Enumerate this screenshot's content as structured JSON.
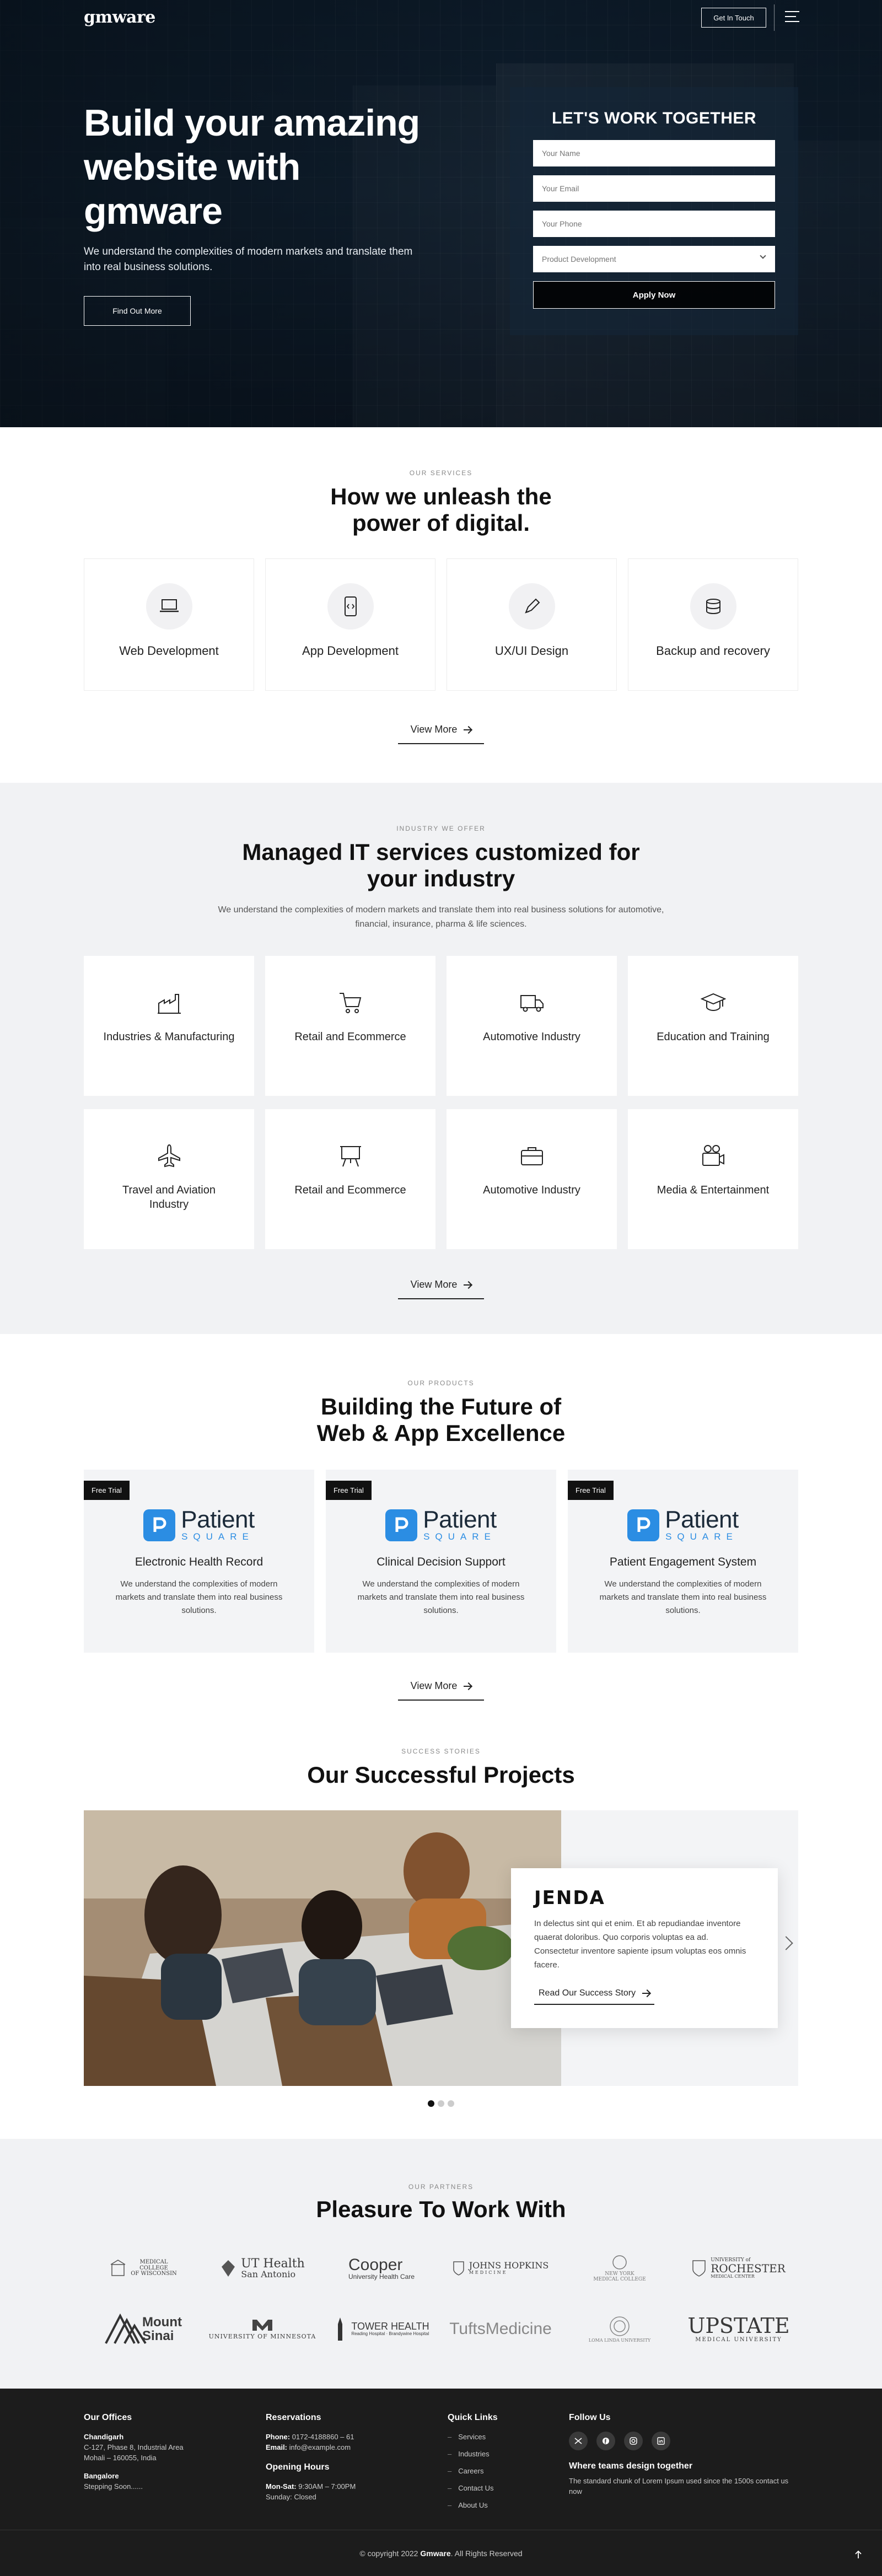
{
  "header": {
    "logo": "gmware",
    "cta_label": "Get In Touch"
  },
  "hero": {
    "title": "Build your amazing website with gmware",
    "subtitle": "We understand the complexities of modern markets and translate them into real business solutions.",
    "cta_label": "Find Out More"
  },
  "form": {
    "title": "LET'S WORK TOGETHER",
    "name_placeholder": "Your Name",
    "email_placeholder": "Your Email",
    "phone_placeholder": "Your Phone",
    "select_value": "Product Development",
    "submit_label": "Apply Now"
  },
  "services": {
    "eyebrow": "OUR SERVICES",
    "title": "How we unleash the power of digital.",
    "items": [
      {
        "label": "Web Development",
        "icon": "laptop-icon"
      },
      {
        "label": "App Development",
        "icon": "mobile-code-icon"
      },
      {
        "label": "UX/UI Design",
        "icon": "pen-icon"
      },
      {
        "label": "Backup and recovery",
        "icon": "database-icon"
      }
    ],
    "view_more": "View More"
  },
  "industries": {
    "eyebrow": "INDUSTRY WE OFFER",
    "title": "Managed IT services customized for your industry",
    "description": "We understand the complexities of modern markets and translate them into real business solutions for automotive, financial, insurance, pharma & life sciences.",
    "items": [
      {
        "label": "Industries & Manufacturing",
        "icon": "factory-icon"
      },
      {
        "label": "Retail and Ecommerce",
        "icon": "cart-icon"
      },
      {
        "label": "Automotive Industry",
        "icon": "truck-icon"
      },
      {
        "label": "Education and Training",
        "icon": "graduation-cap-icon"
      },
      {
        "label": "Travel and Aviation Industry",
        "icon": "airplane-icon"
      },
      {
        "label": "Retail and Ecommerce",
        "icon": "easel-icon"
      },
      {
        "label": "Automotive Industry",
        "icon": "briefcase-icon"
      },
      {
        "label": "Media & Entertainment",
        "icon": "camera-icon"
      }
    ],
    "view_more": "View More"
  },
  "products": {
    "eyebrow": "OUR PRODUCTS",
    "title": "Building the Future of Web & App Excellence",
    "badge": "Free Trial",
    "brand_word": "Patient",
    "brand_sub": "SQUARE",
    "items": [
      {
        "name": "Electronic Health Record",
        "desc": "We understand the complexities of modern markets and translate them into real business solutions."
      },
      {
        "name": "Clinical Decision Support",
        "desc": "We understand the complexities of modern markets and translate them into real business solutions."
      },
      {
        "name": "Patient Engagement System",
        "desc": "We understand the complexities of modern markets and translate them into real business solutions."
      }
    ],
    "view_more": "View More"
  },
  "projects": {
    "eyebrow": "SUCCESS STORIES",
    "title": "Our Successful Projects",
    "client": "JENDA",
    "text": "In delectus sint qui et enim. Et ab repudiandae inventore quaerat doloribus. Quo corporis voluptas ea ad. Consectetur inventore sapiente ipsum voluptas eos omnis facere.",
    "link": "Read Our Success Story",
    "slide_count": 3,
    "active_slide": 1
  },
  "partners": {
    "eyebrow": "OUR PARTNERS",
    "title": "Pleasure To Work With",
    "logos": [
      {
        "name": "Medical College of Wisconsin",
        "l1": "MEDICAL",
        "l2": "COLLEGE",
        "l3": "OF WISCONSIN"
      },
      {
        "name": "UT Health San Antonio",
        "l1": "UT Health",
        "l2": "San Antonio"
      },
      {
        "name": "Cooper University Health Care",
        "l1": "Cooper",
        "l2": "University Health Care"
      },
      {
        "name": "Johns Hopkins Medicine",
        "l1": "JOHNS HOPKINS",
        "l2": "MEDICINE"
      },
      {
        "name": "New York Medical College",
        "l1": "NEW YORK",
        "l2": "MEDICAL COLLEGE"
      },
      {
        "name": "University of Rochester Medical Center",
        "l1": "UNIVERSITY of",
        "l2": "ROCHESTER",
        "l3": "MEDICAL CENTER"
      },
      {
        "name": "Mount Sinai",
        "l1": "Mount",
        "l2": "Sinai"
      },
      {
        "name": "University of Minnesota",
        "l1": "UNIVERSITY OF MINNESOTA"
      },
      {
        "name": "Tower Health",
        "l1": "TOWER HEALTH",
        "l2": "Reading Hospital · Brandywine Hospital"
      },
      {
        "name": "Tufts Medicine",
        "l1": "TuftsMedicine"
      },
      {
        "name": "Loma Linda University",
        "l1": "LOMA LINDA UNIVERSITY"
      },
      {
        "name": "Upstate Medical University",
        "l1": "UPSTATE",
        "l2": "MEDICAL UNIVERSITY"
      }
    ]
  },
  "footer": {
    "offices": {
      "heading": "Our Offices",
      "city1": "Chandigarh",
      "addr1": "C-127, Phase 8, Industrial Area",
      "addr2": "Mohali – 160055, India",
      "city2": "Bangalore",
      "addr3": "Stepping Soon......"
    },
    "reservations": {
      "heading": "Reservations",
      "phone_label": "Phone:",
      "phone": "0172-4188860 – 61",
      "email_label": "Email:",
      "email": "info@example.com",
      "hours_heading": "Opening Hours",
      "hours_label": "Mon-Sat:",
      "hours": "9:30AM – 7:00PM",
      "sunday": "Sunday: Closed"
    },
    "quick_links": {
      "heading": "Quick Links",
      "items": [
        "Services",
        "Industries",
        "Careers",
        "Contact Us",
        "About Us"
      ]
    },
    "follow": {
      "heading": "Follow Us",
      "icons": [
        "twitter-icon",
        "facebook-icon",
        "instagram-icon",
        "linkedin-icon"
      ],
      "tag_heading": "Where teams design together",
      "tag_text": "The standard chunk of Lorem Ipsum used since the 1500s contact us now"
    },
    "copyright_pre": "© copyright 2022",
    "copyright_brand": "Gmware",
    "copyright_post": ". All Rights Reserved"
  }
}
